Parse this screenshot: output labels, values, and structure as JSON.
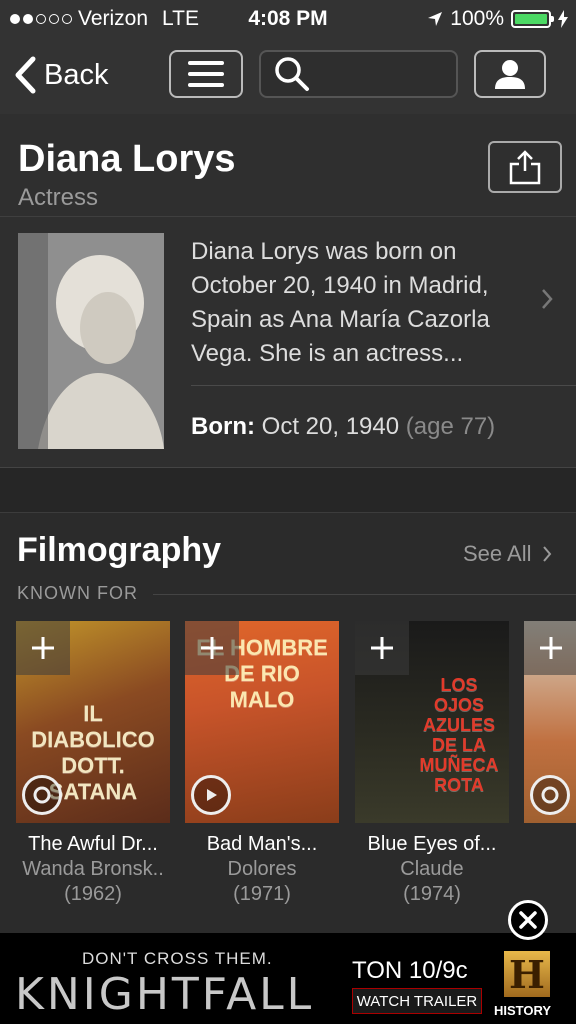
{
  "status_bar": {
    "carrier": "Verizon",
    "network": "LTE",
    "time": "4:08 PM",
    "battery": "100%",
    "battery_level": 1.0,
    "signal_bars": 2
  },
  "nav": {
    "back_label": "Back",
    "search_placeholder": ""
  },
  "person": {
    "name": "Diana Lorys",
    "role": "Actress",
    "bio": "Diana Lorys was born on October 20, 1940 in Madrid, Spain as Ana María Cazorla Vega. She is an actress...",
    "born_label": "Born:",
    "born_date": "Oct 20, 1940",
    "born_age": "(age 77)"
  },
  "filmography": {
    "title": "Filmography",
    "see_all": "See All",
    "known_for": "KNOWN FOR",
    "films": [
      {
        "title": "The Awful Dr...",
        "role": "Wanda Bronsk..",
        "year": "(1962)",
        "poster_text": "IL DIABOLICO DOTT. SATANA",
        "poster_colors": [
          "#c2962a",
          "#5b2c1a"
        ]
      },
      {
        "title": "Bad Man's...",
        "role": "Dolores",
        "year": "(1971)",
        "poster_text": "EL HOMBRE DE RIO MALO",
        "poster_colors": [
          "#e0662a",
          "#8a3d1a"
        ]
      },
      {
        "title": "Blue Eyes of...",
        "role": "Claude",
        "year": "(1974)",
        "poster_text": "LOS OJOS AZULES DE LA MUÑECA ROTA",
        "poster_colors": [
          "#1a1a1a",
          "#3a3a2a"
        ]
      },
      {
        "title": "",
        "role": "",
        "year": "",
        "poster_text": "",
        "poster_colors": [
          "#d8d0c0",
          "#a06030"
        ]
      }
    ]
  },
  "ad": {
    "tagline": "DON'T CROSS THEM.",
    "title": "KNIGHTFALL",
    "time": "TON 10/9c",
    "button": "WATCH TRAILER",
    "brand": "HISTORY",
    "brand_letter": "H"
  }
}
